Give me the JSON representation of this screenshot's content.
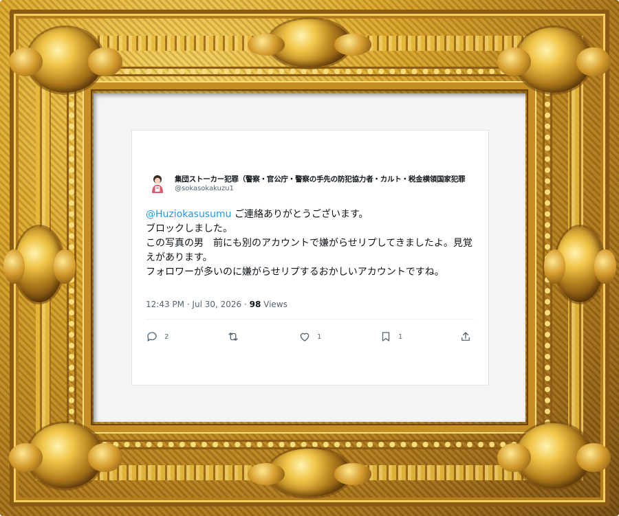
{
  "tweet": {
    "display_name": "集団ストーカー犯罪（警察・官公庁・警察の手先の防犯協力者・カルト・税金横領国家犯罪",
    "handle": "@sokasokakuzu1",
    "mention": "@Huziokasusumu",
    "body": " ご連絡ありがとうございます。\nブロックしました。\nこの写真の男　前にも別のアカウントで嫌がらせリプしてきましたよ。見覚えがあります。\nフォロワーが多いのに嫌がらせリプするおかしいアカウントですね。",
    "timestamp": "12:43 PM · Jul 30, 2026 · ",
    "views_count": "98",
    "views_label": " Views",
    "replies": "2",
    "retweets": "",
    "likes": "1",
    "bookmarks": "1"
  },
  "icons": {
    "reply": "reply-icon",
    "retweet": "retweet-icon",
    "like": "heart-icon",
    "bookmark": "bookmark-icon",
    "share": "share-icon"
  },
  "colors": {
    "mention": "#1d9bf0",
    "secondary_text": "#536471",
    "frame_gold": "#d9a52a"
  }
}
